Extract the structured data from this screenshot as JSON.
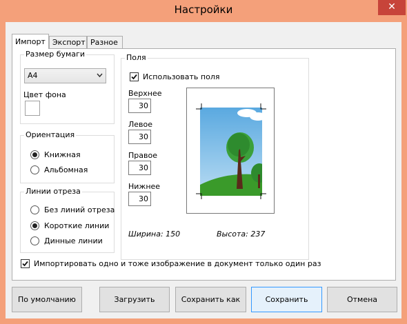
{
  "window": {
    "title": "Настройки",
    "close_glyph": "✕"
  },
  "tabs": [
    {
      "label": "Импорт"
    },
    {
      "label": "Экспорт"
    },
    {
      "label": "Разное"
    }
  ],
  "paper": {
    "title": "Размер бумаги",
    "size": "A4",
    "bg_label": "Цвет фона"
  },
  "orientation": {
    "title": "Ориентация",
    "options": [
      {
        "label": "Книжная",
        "checked": true
      },
      {
        "label": "Альбомная",
        "checked": false
      }
    ]
  },
  "cutlines": {
    "title": "Линии отреза",
    "options": [
      {
        "label": "Без линий отреза",
        "checked": false
      },
      {
        "label": "Короткие линии",
        "checked": true
      },
      {
        "label": "Динные линии",
        "checked": false
      }
    ]
  },
  "margins": {
    "title": "Поля",
    "use_label": "Использовать поля",
    "use_checked": true,
    "top_label": "Верхнее",
    "top": "30",
    "left_label": "Левое",
    "left": "30",
    "right_label": "Правое",
    "right": "30",
    "bottom_label": "Нижнее",
    "bottom": "30",
    "width_text": "Ширина: 150",
    "height_text": "Высота: 237"
  },
  "import_once": {
    "label": "Импортировать одно и тоже изображение в документ только один раз",
    "checked": true
  },
  "buttons": {
    "default": "По умолчанию",
    "load": "Загрузить",
    "save_as": "Сохранить как",
    "save": "Сохранить",
    "cancel": "Отмена"
  },
  "colors": {
    "title_bar": "#f4a07a",
    "sky": "#6ab7e8",
    "grass": "#3a9a2a",
    "tree": "#2e8b2e",
    "trunk": "#5a2a1a"
  },
  "icons": {
    "check": "check-icon",
    "dropdown": "chevron-down-icon"
  }
}
